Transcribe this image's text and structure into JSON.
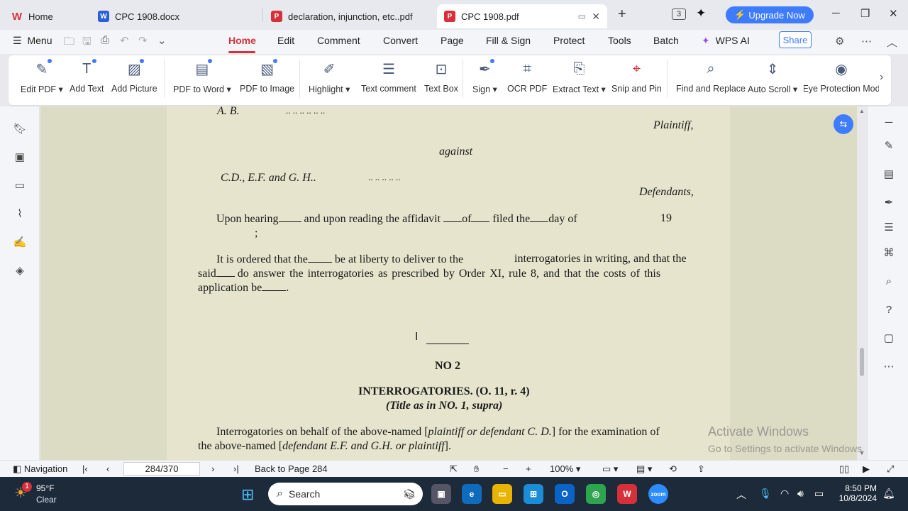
{
  "tabs": [
    {
      "label": "Home",
      "icon": "wps-logo-icon",
      "color": "#d6303a"
    },
    {
      "label": "CPC 1908.docx",
      "icon": "word-doc-icon",
      "color": "#2b5fd9"
    },
    {
      "label": "declaration, injunction, etc..pdf",
      "icon": "pdf-icon",
      "color": "#d6303a"
    },
    {
      "label": "CPC 1908.pdf",
      "icon": "pdf-icon",
      "color": "#d6303a"
    }
  ],
  "header": {
    "upgrade_label": "Upgrade Now",
    "tab_count": "3"
  },
  "menu": {
    "menu_label": "Menu",
    "items": [
      "Home",
      "Edit",
      "Comment",
      "Convert",
      "Page",
      "Fill & Sign",
      "Protect",
      "Tools",
      "Batch"
    ],
    "ai_label": "WPS AI",
    "share_label": "Share"
  },
  "ribbon": [
    {
      "label": "Edit PDF",
      "icon": "edit-pdf-icon",
      "dropdown": true
    },
    {
      "label": "Add Text",
      "icon": "add-text-icon"
    },
    {
      "label": "Add Picture",
      "icon": "add-picture-icon"
    },
    {
      "label": "PDF to Word",
      "icon": "pdf-to-word-icon",
      "dropdown": true
    },
    {
      "label": "PDF to Image",
      "icon": "pdf-to-image-icon"
    },
    {
      "label": "Highlight",
      "icon": "highlight-icon",
      "dropdown": true
    },
    {
      "label": "Text comment",
      "icon": "text-comment-icon"
    },
    {
      "label": "Text Box",
      "icon": "text-box-icon"
    },
    {
      "label": "Sign",
      "icon": "sign-icon",
      "dropdown": true
    },
    {
      "label": "OCR PDF",
      "icon": "ocr-icon"
    },
    {
      "label": "Extract Text",
      "icon": "extract-text-icon",
      "dropdown": true
    },
    {
      "label": "Snip and Pin",
      "icon": "snip-pin-icon"
    },
    {
      "label": "Find and Replace",
      "icon": "find-replace-icon"
    },
    {
      "label": "Auto Scroll",
      "icon": "auto-scroll-icon",
      "dropdown": true
    },
    {
      "label": "Eye Protection Mod",
      "icon": "eye-protection-icon"
    }
  ],
  "document": {
    "party_ab": "A. B.",
    "dots1": "..                    ..                         ..                         ..                    ..                         ..",
    "plaintiff": "Plaintiff,",
    "against": "against",
    "party_cd": "C.D., E.F. and G. H..",
    "dots2": "..                          ..                              ..                         ..                         ..",
    "defendants": "Defendants,",
    "upon_hearing_1": "Upon hearing",
    "upon_hearing_2": "and upon reading the affidavit",
    "upon_hearing_3": "of",
    "upon_hearing_4": "filed the",
    "upon_hearing_5": "day of",
    "year": "19",
    "semicolon": ";",
    "ordered_1": "It is ordered that the",
    "ordered_2": "be at liberty to deliver to the",
    "ordered_3": "interrogatories in writing, and that the",
    "ordered_line2_a": "said",
    "ordered_line2_b": "do answer the interrogatories as prescribed by Order XI, rule 8, and that the costs of this",
    "ordered_line3": "application be",
    "ordered_line3_end": ".",
    "no2": "NO 2",
    "heading": "INTERROGATORIES. (O. 11, r. 4)",
    "subheading": "(Title as in NO. 1, supra)",
    "interrog_1": "Interrogatories on behalf of the above-named [",
    "interrog_1_it": "plaintiff or defendant C. D.",
    "interrog_1_end": "] for the examination of",
    "interrog_2": "the above-named [",
    "interrog_2_it": "defendant E.F. and G.H. or plaintiff",
    "interrog_2_end": "]."
  },
  "watermark": {
    "line1": "Activate Windows",
    "line2": "Go to Settings to activate Windows."
  },
  "status": {
    "navigation_label": "Navigation",
    "page_indicator": "284/370",
    "back_label": "Back to Page 284",
    "zoom": "100%"
  },
  "taskbar": {
    "temp": "95°F",
    "condition": "Clear",
    "weather_badge": "1",
    "search_placeholder": "Search",
    "time": "8:50 PM",
    "date": "10/8/2024"
  }
}
